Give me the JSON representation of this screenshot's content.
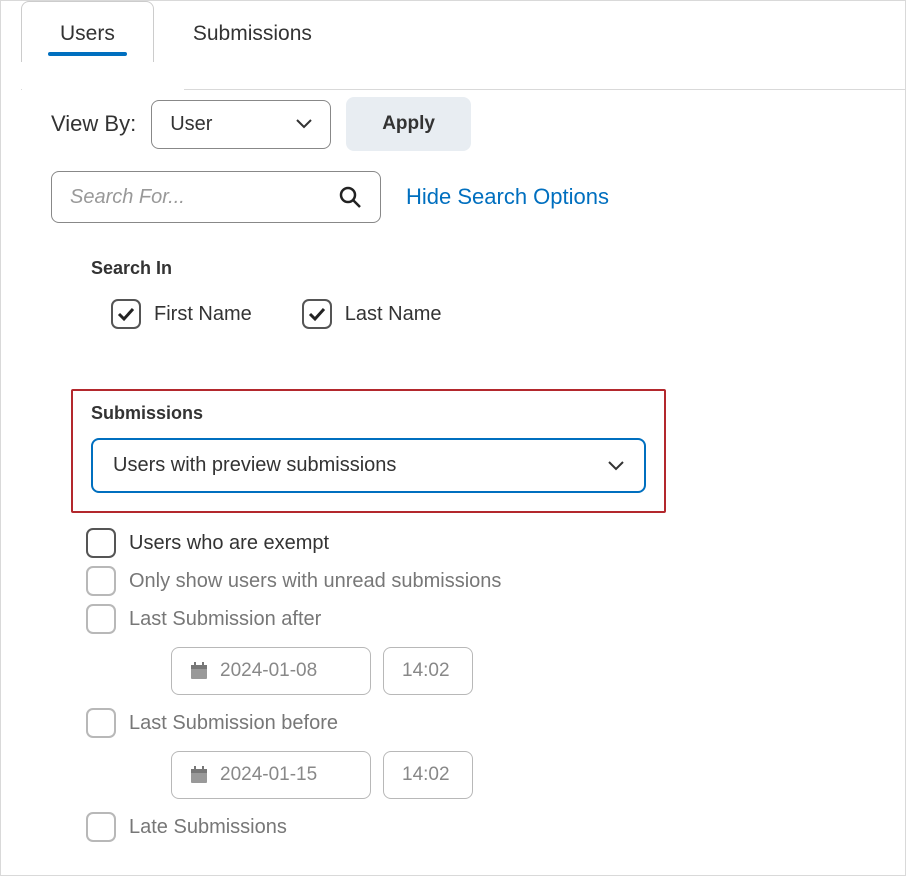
{
  "tabs": {
    "users": "Users",
    "submissions": "Submissions"
  },
  "viewby": {
    "label": "View By:",
    "value": "User",
    "apply": "Apply"
  },
  "search": {
    "placeholder": "Search For...",
    "hide_link": "Hide Search Options"
  },
  "search_in": {
    "header": "Search In",
    "first_name": "First Name",
    "last_name": "Last Name"
  },
  "submissions_filter": {
    "header": "Submissions",
    "selected": "Users with preview submissions"
  },
  "filters": {
    "exempt": "Users who are exempt",
    "unread": "Only show users with unread submissions",
    "after": "Last Submission after",
    "after_date": "2024-01-08",
    "after_time": "14:02",
    "before": "Last Submission before",
    "before_date": "2024-01-15",
    "before_time": "14:02",
    "late": "Late Submissions"
  }
}
